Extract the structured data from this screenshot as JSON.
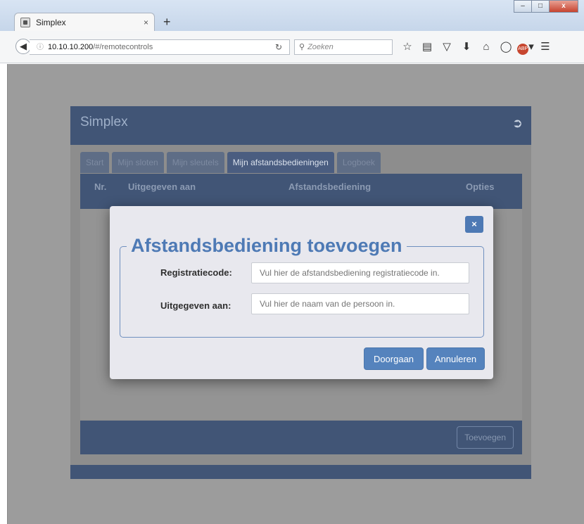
{
  "browser": {
    "tab_title": "Simplex",
    "tab_close": "×",
    "new_tab": "+",
    "url_host": "10.10.10.200",
    "url_path": "/#/remotecontrols",
    "search_placeholder": "Zoeken",
    "window_controls": {
      "minimize": "–",
      "maximize": "□",
      "close": "x"
    }
  },
  "app": {
    "title": "Simplex",
    "tabs": [
      {
        "label": "Start"
      },
      {
        "label": "Mijn sloten"
      },
      {
        "label": "Mijn sleutels"
      },
      {
        "label": "Mijn afstandsbedieningen"
      },
      {
        "label": "Logboek"
      }
    ],
    "table": {
      "columns": [
        "Nr.",
        "Uitgegeven aan",
        "Afstandsbediening",
        "Opties"
      ]
    },
    "footer": {
      "add_label": "Toevoegen"
    }
  },
  "modal": {
    "close_label": "×",
    "title": "Afstandsbediening toevoegen",
    "fields": [
      {
        "label": "Registratiecode:",
        "placeholder": "Vul hier de afstandsbediening registratiecode in."
      },
      {
        "label": "Uitgegeven aan:",
        "placeholder": "Vul hier de naam van de persoon in."
      }
    ],
    "buttons": {
      "confirm": "Doorgaan",
      "cancel": "Annuleren"
    }
  },
  "colors": {
    "header_blue": "#415576",
    "accent_blue": "#4e7ab5",
    "button_blue": "#5583bd"
  }
}
